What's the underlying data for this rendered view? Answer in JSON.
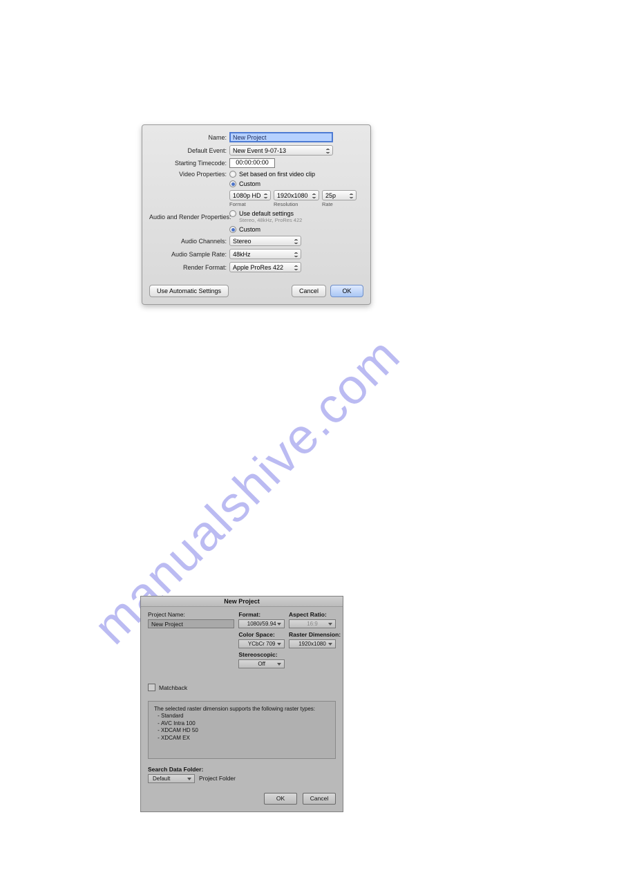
{
  "watermark": "manualshive.com",
  "dlg1": {
    "labels": {
      "name": "Name:",
      "default_event": "Default Event:",
      "starting_timecode": "Starting Timecode:",
      "video_properties": "Video Properties:",
      "audio_render_properties": "Audio and Render Properties:",
      "audio_channels": "Audio Channels:",
      "audio_sample_rate": "Audio Sample Rate:",
      "render_format": "Render Format:"
    },
    "values": {
      "name": "New Project",
      "default_event": "New Event 9-07-13",
      "starting_timecode": "00:00:00:00",
      "radio_set_first_clip": "Set based on first video clip",
      "radio_custom_video": "Custom",
      "format": "1080p HD",
      "resolution": "1920x1080",
      "rate": "25p",
      "radio_use_defaults": "Use default settings",
      "defaults_subtext": "Stereo, 48kHz, ProRes 422",
      "radio_custom_audio": "Custom",
      "audio_channels": "Stereo",
      "sample_rate": "48kHz",
      "render_format": "Apple ProRes 422"
    },
    "captions": {
      "format": "Format",
      "resolution": "Resolution",
      "rate": "Rate"
    },
    "buttons": {
      "auto": "Use Automatic Settings",
      "cancel": "Cancel",
      "ok": "OK"
    }
  },
  "dlg2": {
    "title": "New Project",
    "labels": {
      "project_name": "Project Name:",
      "format": "Format:",
      "aspect_ratio": "Aspect Ratio:",
      "color_space": "Color Space:",
      "raster_dimension": "Raster Dimension:",
      "stereoscopic": "Stereoscopic:",
      "matchback": "Matchback",
      "search_data_folder": "Search Data Folder:",
      "project_folder": "Project Folder"
    },
    "values": {
      "project_name": "New Project",
      "format": "1080i/59.94",
      "aspect_ratio": "16:9",
      "color_space": "YCbCr 709",
      "raster_dimension": "1920x1080",
      "stereoscopic": "Off",
      "search_data_folder": "Default"
    },
    "info_intro": "The selected raster dimension supports the following raster types:",
    "info_list": {
      "i0": "Standard",
      "i1": "AVC Intra 100",
      "i2": "XDCAM HD 50",
      "i3": "XDCAM EX"
    },
    "buttons": {
      "ok": "OK",
      "cancel": "Cancel"
    }
  }
}
